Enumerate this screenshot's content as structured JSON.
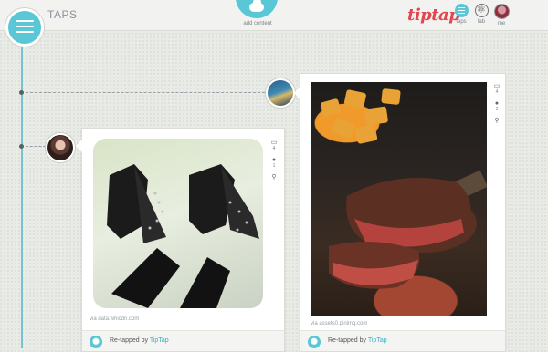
{
  "header": {
    "page_title": "TAPS",
    "add_content_label": "add content",
    "logo_text": "tiptap",
    "nav": [
      {
        "label": "taps",
        "icon": "list-icon"
      },
      {
        "label": "lab",
        "icon": "atom-icon"
      },
      {
        "label": "me",
        "icon": "avatar-icon"
      }
    ]
  },
  "colors": {
    "accent": "#59c7d6",
    "logo": "#e2474f",
    "timeline": "#75c5d1"
  },
  "cards": [
    {
      "source": "via data.whicdn.com",
      "retapped_prefix": "Re-tapped by",
      "retapped_user": "TipTap",
      "tap_count": "4",
      "comment_count": "1"
    },
    {
      "source": "via assets0.pinimg.com",
      "retapped_prefix": "Re-tapped by",
      "retapped_user": "TipTap",
      "tap_count": "4",
      "comment_count": "2"
    }
  ]
}
